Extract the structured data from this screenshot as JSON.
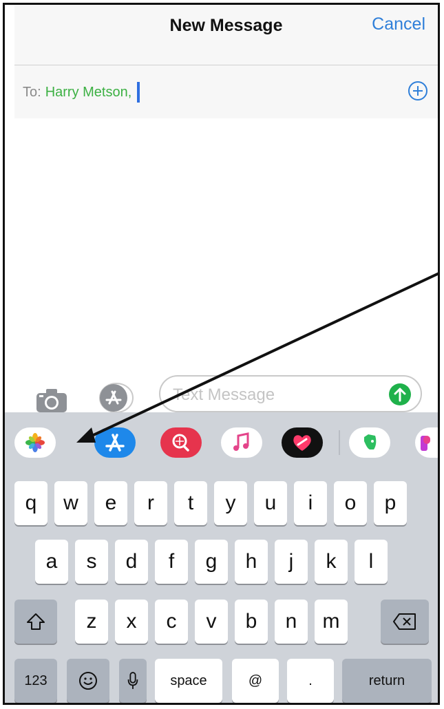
{
  "header": {
    "title": "New Message",
    "cancel_label": "Cancel"
  },
  "compose": {
    "to_label": "To:",
    "recipient": "Harry Metson,"
  },
  "message_input": {
    "placeholder": "Text Message"
  },
  "app_strip": {
    "icons": [
      "photos-icon",
      "app-store-icon",
      "images-search-icon",
      "music-icon",
      "digital-touch-icon",
      "evernote-icon",
      "app-icon-partial"
    ]
  },
  "keyboard": {
    "row1": [
      "q",
      "w",
      "e",
      "r",
      "t",
      "y",
      "u",
      "i",
      "o",
      "p"
    ],
    "row2": [
      "a",
      "s",
      "d",
      "f",
      "g",
      "h",
      "j",
      "k",
      "l"
    ],
    "row3": [
      "z",
      "x",
      "c",
      "v",
      "b",
      "n",
      "m"
    ],
    "numbers_label": "123",
    "space_label": "space",
    "at_label": "@",
    "dot_label": ".",
    "return_label": "return"
  },
  "colors": {
    "accent": "#2f7fd9",
    "recipient": "#3cb043",
    "send": "#1fb14b",
    "keyboard_bg": "#cfd3d9"
  }
}
